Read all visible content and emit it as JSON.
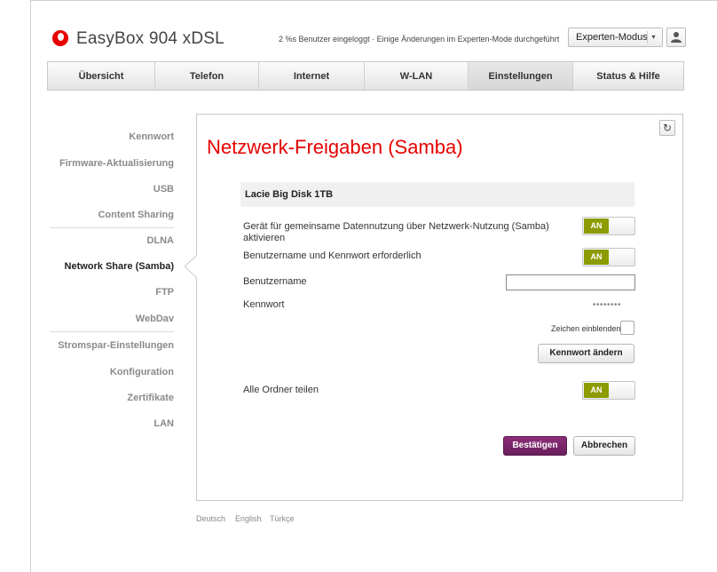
{
  "app": {
    "title": "EasyBox 904 xDSL",
    "status": "2 %s Benutzer eingeloggt · Einige Änderungen im Experten-Mode durchgeführt",
    "mode": "Experten-Modus",
    "brand_color": "#e60000"
  },
  "nav": {
    "tabs": [
      {
        "label": "Übersicht"
      },
      {
        "label": "Telefon"
      },
      {
        "label": "Internet"
      },
      {
        "label": "W-LAN"
      },
      {
        "label": "Einstellungen"
      },
      {
        "label": "Status & Hilfe"
      }
    ],
    "active": "Einstellungen"
  },
  "sidebar": {
    "items": [
      {
        "label": "Kennwort"
      },
      {
        "label": "Firmware-Aktualisierung"
      },
      {
        "label": "USB"
      },
      {
        "label": "Content Sharing"
      },
      {
        "label": "DLNA"
      },
      {
        "label": "Network Share (Samba)"
      },
      {
        "label": "FTP"
      },
      {
        "label": "WebDav"
      },
      {
        "label": "Stromspar-Einstellungen"
      },
      {
        "label": "Konfiguration"
      },
      {
        "label": "Zertifikate"
      },
      {
        "label": "LAN"
      }
    ],
    "active": "Network Share (Samba)"
  },
  "main": {
    "title": "Netzwerk-Freigaben (Samba)",
    "section": "Lacie Big Disk 1TB",
    "enable_samba_label": "Gerät für gemeinsame Datennutzung über Netzwerk-Nutzung (Samba) aktivieren",
    "enable_samba_state": "AN",
    "auth_required_label": "Benutzername und Kennwort erforderlich",
    "auth_required_state": "AN",
    "username_label": "Benutzername",
    "username_value": "",
    "password_label": "Kennwort",
    "password_value": "••••••••",
    "show_chars_label": "Zeichen einblenden",
    "change_password_button": "Kennwort ändern",
    "share_all_label": "Alle Ordner teilen",
    "share_all_state": "AN",
    "toggle_color": "#8c9b00",
    "confirm_button": "Bestätigen",
    "cancel_button": "Abbrechen"
  },
  "footer": {
    "languages": [
      "Deutsch",
      "English",
      "Türkçe"
    ]
  }
}
